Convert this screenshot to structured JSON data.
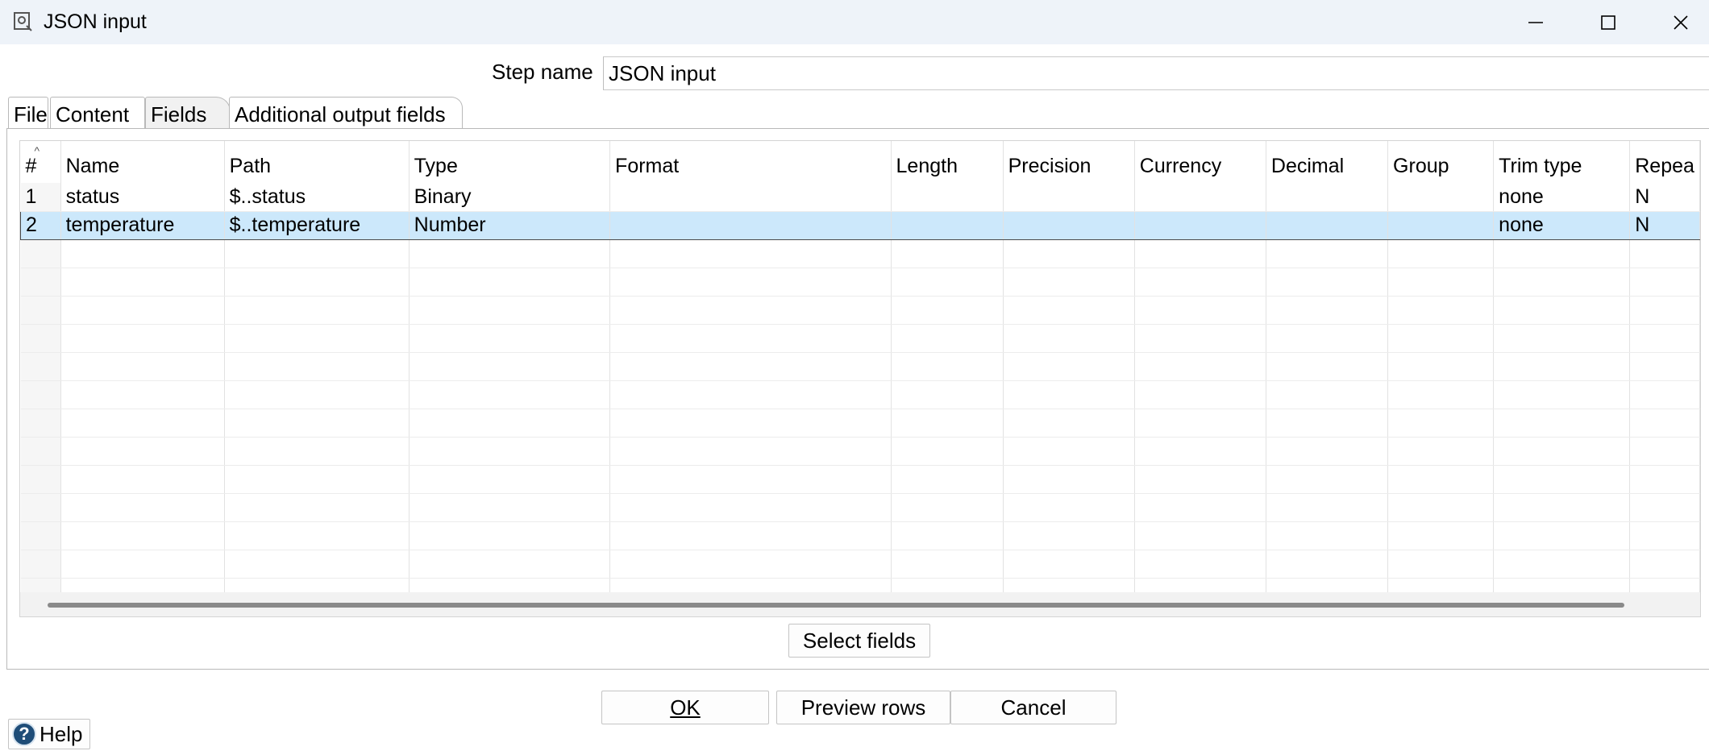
{
  "window": {
    "title": "JSON input",
    "icon": "json-input-step-icon"
  },
  "step": {
    "label": "Step name",
    "value": "JSON input"
  },
  "tabs": [
    {
      "label": "File"
    },
    {
      "label": "Content"
    },
    {
      "label": "Fields",
      "active": true
    },
    {
      "label": "Additional output fields"
    }
  ],
  "grid": {
    "columns": [
      "#",
      "Name",
      "Path",
      "Type",
      "Format",
      "Length",
      "Precision",
      "Currency",
      "Decimal",
      "Group",
      "Trim type",
      "Repea"
    ],
    "rows": [
      {
        "num": "1",
        "name": "status",
        "path": "$..status",
        "type": "Binary",
        "format": "",
        "length": "",
        "precision": "",
        "currency": "",
        "decimal": "",
        "group": "",
        "trim": "none",
        "repeat": "N"
      },
      {
        "num": "2",
        "name": "temperature",
        "path": "$..temperature",
        "type": "Number",
        "format": "",
        "length": "",
        "precision": "",
        "currency": "",
        "decimal": "",
        "group": "",
        "trim": "none",
        "repeat": "N",
        "selected": true
      }
    ]
  },
  "buttons": {
    "select_fields": "Select fields",
    "ok": "OK",
    "preview_rows": "Preview rows",
    "cancel": "Cancel",
    "help": "Help"
  }
}
